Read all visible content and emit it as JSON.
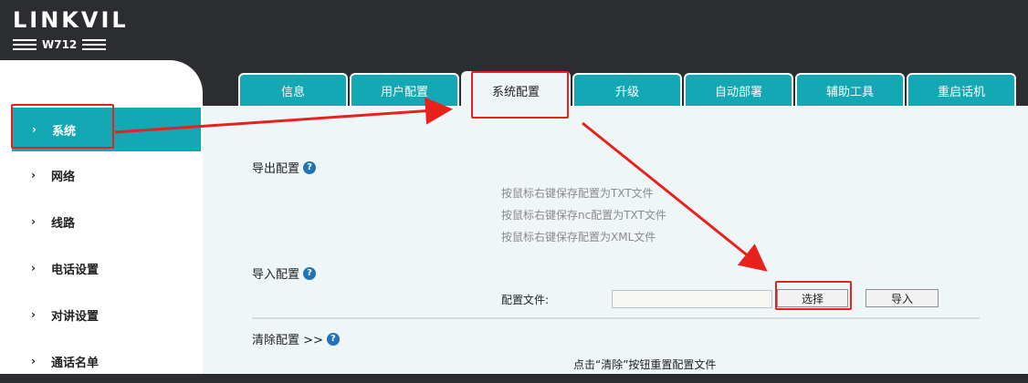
{
  "brand": {
    "name": "LINKVIL",
    "model": "W712"
  },
  "tabs": [
    {
      "label": "信息"
    },
    {
      "label": "用户配置"
    },
    {
      "label": "系统配置"
    },
    {
      "label": "升级"
    },
    {
      "label": "自动部署"
    },
    {
      "label": "辅助工具"
    },
    {
      "label": "重启话机"
    }
  ],
  "sidebar": {
    "chevron": "›",
    "items": [
      {
        "label": "系统"
      },
      {
        "label": "网络"
      },
      {
        "label": "线路"
      },
      {
        "label": "电话设置"
      },
      {
        "label": "对讲设置"
      },
      {
        "label": "通话名单"
      }
    ]
  },
  "export": {
    "title": "导出配置",
    "hints": [
      "按鼠标右键保存配置为TXT文件",
      "按鼠标右键保存nc配置为TXT文件",
      "按鼠标右键保存配置为XML文件"
    ]
  },
  "import": {
    "title": "导入配置",
    "file_label": "配置文件:",
    "file_value": "",
    "select_label": "选择",
    "import_label": "导入"
  },
  "clear": {
    "title": "清除配置 >>",
    "hint": "点击“清除”按钮重置配置文件"
  },
  "help_glyph": "?",
  "colors": {
    "accent": "#13a8b4",
    "header": "#2b2d30",
    "content": "#eff6f8",
    "annotation": "#e8211c",
    "help": "#1f73b7"
  }
}
